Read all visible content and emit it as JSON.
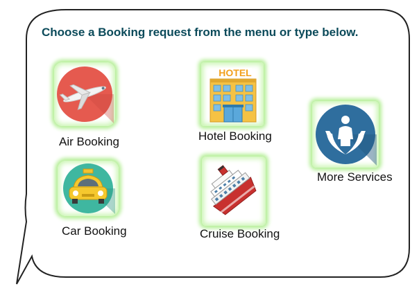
{
  "prompt": "Choose a Booking request from the menu or type below.",
  "menu": {
    "air": {
      "label": "Air Booking",
      "icon": "airplane-icon"
    },
    "hotel": {
      "label": "Hotel Booking",
      "icon": "hotel-icon",
      "sign": "HOTEL"
    },
    "services": {
      "label": "More Services",
      "icon": "care-hands-icon"
    },
    "car": {
      "label": "Car Booking",
      "icon": "taxi-icon"
    },
    "cruise": {
      "label": "Cruise Booking",
      "icon": "cruise-ship-icon"
    }
  },
  "colors": {
    "prompt_text": "#0b4a5a",
    "bubble_border": "#222222",
    "glow": "#b7ef9a",
    "air_circle": "#e55a4f",
    "car_circle": "#3fb7a0",
    "services_circle": "#2f6e9e"
  }
}
